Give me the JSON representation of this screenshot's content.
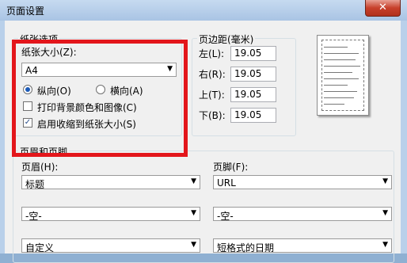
{
  "window": {
    "title": "页面设置",
    "close_glyph": "✕"
  },
  "paper": {
    "group_title": "纸张选项",
    "size_label": "纸张大小(Z):",
    "size_value": "A4",
    "portrait_label": "纵向(O)",
    "landscape_label": "横向(A)",
    "orientation_selected": "portrait",
    "print_bg_label": "打印背景颜色和图像(C)",
    "print_bg_checked": false,
    "shrink_label": "启用收缩到纸张大小(S)",
    "shrink_checked": true
  },
  "margins": {
    "group_title": "页边距(毫米)",
    "left_label": "左(L):",
    "left_value": "19.05",
    "right_label": "右(R):",
    "right_value": "19.05",
    "top_label": "上(T):",
    "top_value": "19.05",
    "bottom_label": "下(B):",
    "bottom_value": "19.05"
  },
  "header_footer": {
    "group_title": "页眉和页脚",
    "header_label": "页眉(H):",
    "footer_label": "页脚(F):",
    "header_values": [
      "标题",
      "-空-",
      "自定义"
    ],
    "footer_values": [
      "URL",
      "-空-",
      "短格式的日期"
    ]
  },
  "icons": {
    "dropdown": "chevron-down-icon",
    "check": "checkmark-icon"
  },
  "colors": {
    "highlight": "#e3161b",
    "radio_dot": "#1b5ab7"
  }
}
